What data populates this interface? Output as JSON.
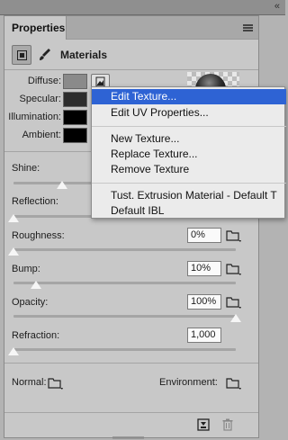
{
  "panel": {
    "tab_title": "Properties",
    "header_title": "Materials",
    "collapse_icon": "double-chevron-left-icon",
    "menu_icon": "hamburger-menu-icon"
  },
  "swatches": [
    {
      "label": "Diffuse:",
      "color": "#8a8a8a"
    },
    {
      "label": "Specular:",
      "color": "#2d2d2d"
    },
    {
      "label": "Illumination:",
      "color": "#000000"
    },
    {
      "label": "Ambient:",
      "color": "#000000"
    }
  ],
  "properties": [
    {
      "label": "Shine:",
      "slider": 0.22
    },
    {
      "label": "Reflection:",
      "slider": 0.0
    },
    {
      "label": "Roughness:",
      "value": "0%",
      "slider": 0.0
    },
    {
      "label": "Bump:",
      "value": "10%",
      "slider": 0.1
    },
    {
      "label": "Opacity:",
      "value": "100%",
      "slider": 1.0
    },
    {
      "label": "Refraction:",
      "value": "1,000",
      "slider": 0.0
    }
  ],
  "bottom": {
    "normal_label": "Normal:",
    "environment_label": "Environment:"
  },
  "context_menu": {
    "items": [
      "Edit Texture...",
      "Edit UV Properties...",
      "New Texture...",
      "Replace Texture...",
      "Remove Texture",
      "Tust. Extrusion Material - Default T",
      "Default IBL"
    ],
    "selected_index": 0,
    "highlight_color": "#2e63d4"
  }
}
